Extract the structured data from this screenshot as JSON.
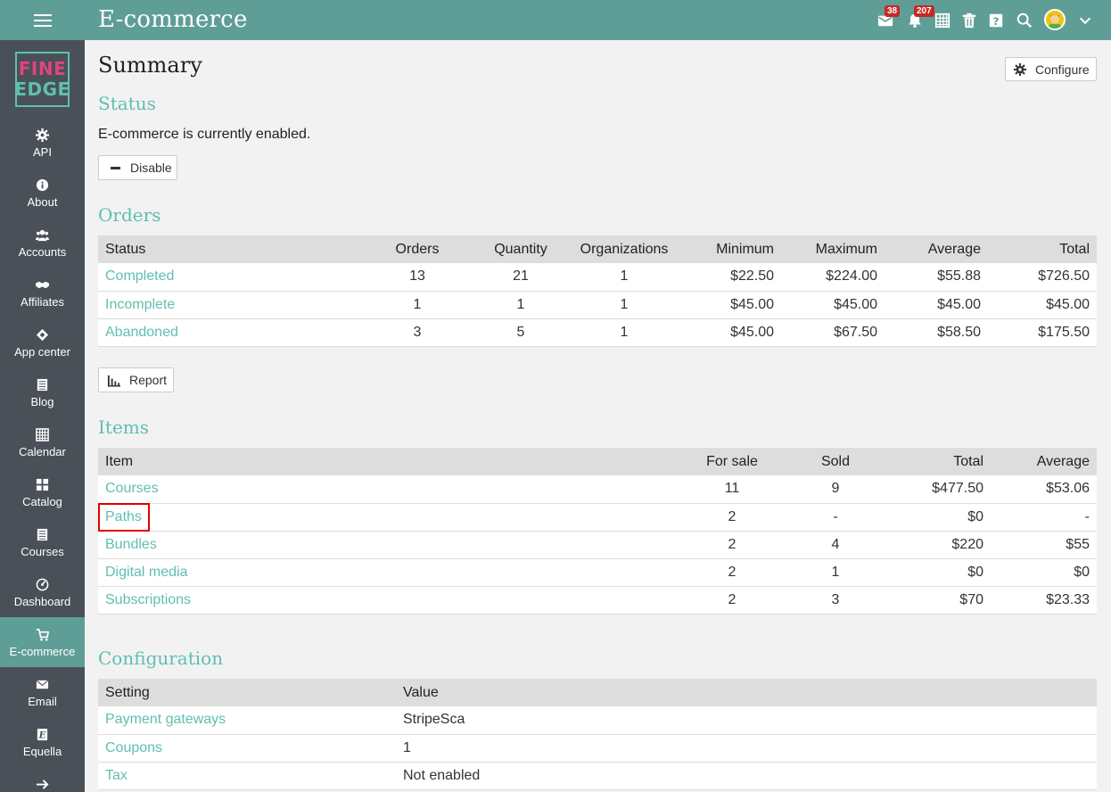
{
  "app": {
    "title": "E-commerce"
  },
  "topbar": {
    "mail_badge": "38",
    "notifications_badge": "207"
  },
  "sidebar": {
    "logo_line1": "FINE",
    "logo_line2": "EDGE",
    "items": [
      {
        "label": "API",
        "icon": "gear-icon"
      },
      {
        "label": "About",
        "icon": "info-icon"
      },
      {
        "label": "Accounts",
        "icon": "users-icon"
      },
      {
        "label": "Affiliates",
        "icon": "handshake-icon"
      },
      {
        "label": "App center",
        "icon": "puzzle-icon"
      },
      {
        "label": "Blog",
        "icon": "blog-icon"
      },
      {
        "label": "Calendar",
        "icon": "calendar-icon"
      },
      {
        "label": "Catalog",
        "icon": "grid-icon"
      },
      {
        "label": "Courses",
        "icon": "courses-icon"
      },
      {
        "label": "Dashboard",
        "icon": "dashboard-icon"
      },
      {
        "label": "E-commerce",
        "icon": "cart-icon",
        "active": true
      },
      {
        "label": "Email",
        "icon": "email-icon"
      },
      {
        "label": "Equella",
        "icon": "equella-icon"
      },
      {
        "label": "",
        "icon": "arrow-right-icon"
      }
    ]
  },
  "page": {
    "title": "Summary",
    "configure_label": "Configure"
  },
  "status": {
    "heading": "Status",
    "text": "E-commerce is currently enabled.",
    "disable_label": "Disable"
  },
  "orders": {
    "heading": "Orders",
    "columns": [
      "Status",
      "Orders",
      "Quantity",
      "Organizations",
      "Minimum",
      "Maximum",
      "Average",
      "Total"
    ],
    "rows": [
      [
        "Completed",
        "13",
        "21",
        "1",
        "$22.50",
        "$224.00",
        "$55.88",
        "$726.50"
      ],
      [
        "Incomplete",
        "1",
        "1",
        "1",
        "$45.00",
        "$45.00",
        "$45.00",
        "$45.00"
      ],
      [
        "Abandoned",
        "3",
        "5",
        "1",
        "$45.00",
        "$67.50",
        "$58.50",
        "$175.50"
      ]
    ],
    "report_label": "Report"
  },
  "items": {
    "heading": "Items",
    "columns": [
      "Item",
      "For sale",
      "Sold",
      "Total",
      "Average"
    ],
    "rows": [
      [
        "Courses",
        "11",
        "9",
        "$477.50",
        "$53.06"
      ],
      [
        "Paths",
        "2",
        "-",
        "$0",
        "-"
      ],
      [
        "Bundles",
        "2",
        "4",
        "$220",
        "$55"
      ],
      [
        "Digital media",
        "2",
        "1",
        "$0",
        "$0"
      ],
      [
        "Subscriptions",
        "2",
        "3",
        "$70",
        "$23.33"
      ]
    ]
  },
  "configuration": {
    "heading": "Configuration",
    "columns": [
      "Setting",
      "Value"
    ],
    "rows": [
      [
        "Payment gateways",
        "StripeSca"
      ],
      [
        "Coupons",
        "1"
      ],
      [
        "Tax",
        "Not enabled"
      ]
    ]
  },
  "colors": {
    "topbar": "#5f9e96",
    "sidebar": "#4a5057",
    "accent": "#5fbfb0",
    "badge": "#c62828",
    "highlight": "#e00000"
  }
}
